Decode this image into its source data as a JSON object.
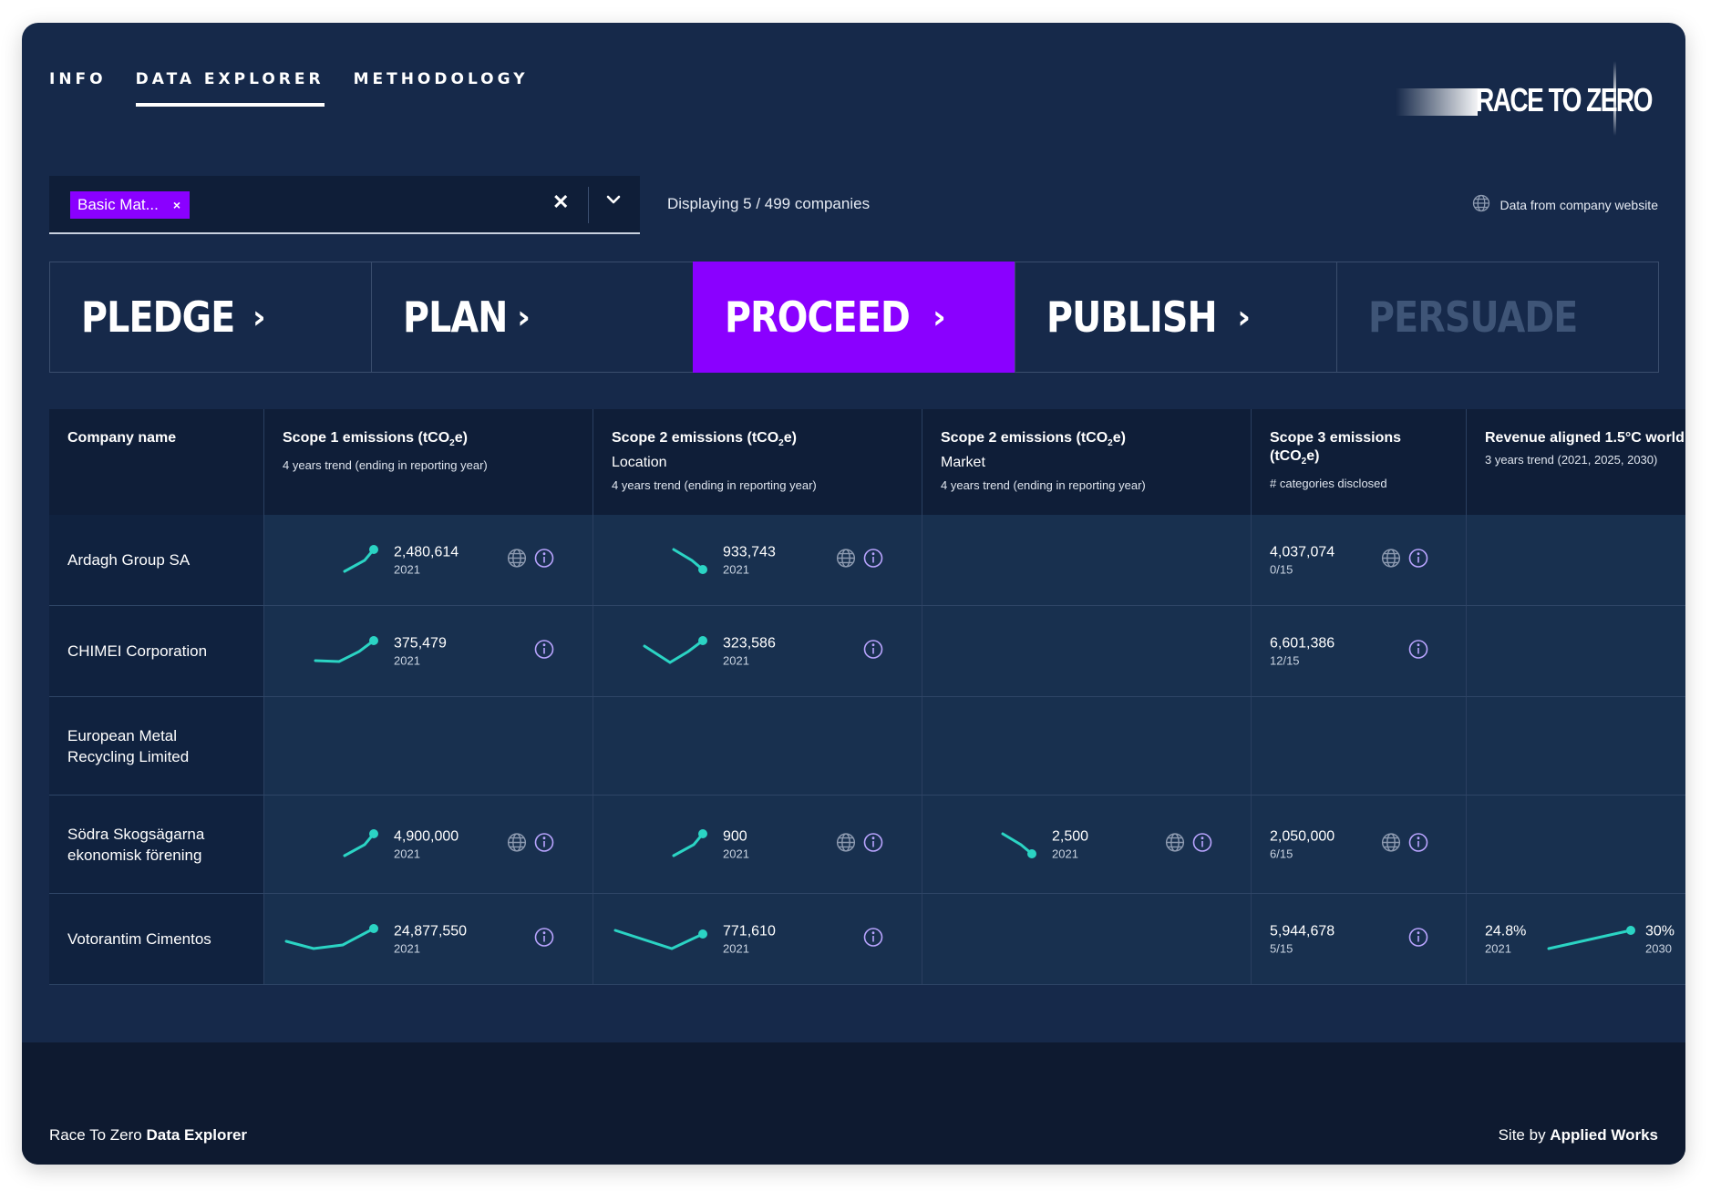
{
  "nav": {
    "tabs": [
      "INFO",
      "DATA EXPLORER",
      "METHODOLOGY"
    ],
    "active": 1
  },
  "logo": {
    "text": "RACE TO ZERO"
  },
  "filter": {
    "chip_label": "Basic Mat...",
    "chip_remove": "×",
    "clear_glyph": "✕"
  },
  "status": {
    "displaying": "Displaying 5 / 499 companies"
  },
  "source_legend": {
    "label": "Data from company website"
  },
  "stages": [
    {
      "label": "PLEDGE",
      "arrow": "›"
    },
    {
      "label": "PLAN",
      "arrow": "›"
    },
    {
      "label": "PROCEED",
      "arrow": "›"
    },
    {
      "label": "PUBLISH",
      "arrow": "›"
    },
    {
      "label": "PERSUADE",
      "arrow": ""
    }
  ],
  "table": {
    "headers": {
      "company": "Company name",
      "scope1_a": "Scope 1 emissions (tCO",
      "scope1_sub": "2",
      "scope1_b": "e)",
      "scope1_note": "4 years trend (ending in reporting year)",
      "scope2l_a": "Scope 2 emissions (tCO",
      "scope2l_sub": "2",
      "scope2l_b": "e)",
      "scope2l_kind": "Location",
      "scope2l_note": "4 years trend (ending in reporting year)",
      "scope2m_a": "Scope 2 emissions (tCO",
      "scope2m_sub": "2",
      "scope2m_b": "e)",
      "scope2m_kind": "Market",
      "scope2m_note": "4 years trend (ending in reporting year)",
      "scope3_line1": "Scope 3 emissions",
      "scope3_a": "(tCO",
      "scope3_sub": "2",
      "scope3_b": "e)",
      "scope3_note": "# categories disclosed",
      "revenue": "Revenue aligned 1.5°C world",
      "revenue_note": "3 years trend (2021, 2025, 2030)"
    },
    "rows": [
      {
        "company": "Ardagh Group SA",
        "s1": {
          "value": "2,480,614",
          "year": "2021"
        },
        "s2l": {
          "value": "933,743",
          "year": "2021"
        },
        "s3": {
          "value": "4,037,074",
          "cats": "0/15"
        }
      },
      {
        "company": "CHIMEI Corporation",
        "s1": {
          "value": "375,479",
          "year": "2021"
        },
        "s2l": {
          "value": "323,586",
          "year": "2021"
        },
        "s3": {
          "value": "6,601,386",
          "cats": "12/15"
        }
      },
      {
        "company": "European Metal Recycling Limited"
      },
      {
        "company": "Södra Skogsägarna ekonomisk förening",
        "s1": {
          "value": "4,900,000",
          "year": "2021"
        },
        "s2l": {
          "value": "900",
          "year": "2021"
        },
        "s2m": {
          "value": "2,500",
          "year": "2021"
        },
        "s3": {
          "value": "2,050,000",
          "cats": "6/15"
        }
      },
      {
        "company": "Votorantim Cimentos",
        "s1": {
          "value": "24,877,550",
          "year": "2021"
        },
        "s2l": {
          "value": "771,610",
          "year": "2021"
        },
        "s3": {
          "value": "5,944,678",
          "cats": "5/15"
        },
        "rev": {
          "start": "24.8%",
          "start_year": "2021",
          "end": "30%",
          "end_year": "2030"
        }
      }
    ]
  },
  "footer": {
    "left_plain": "Race To Zero ",
    "left_bold": "Data Explorer",
    "right_plain": "Site by ",
    "right_bold": "Applied Works"
  },
  "colors": {
    "accent": "#8a00ff",
    "trend": "#2bd4c4",
    "info": "#b9a4ff",
    "background": "#16294a"
  },
  "icons": [
    "globe-icon",
    "info-icon",
    "close-icon",
    "chevron-down-icon"
  ]
}
